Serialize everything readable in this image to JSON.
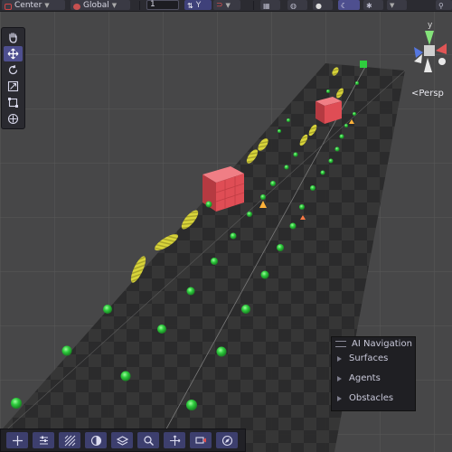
{
  "toolbar": {
    "pivot_label": "Center",
    "space_label": "Global",
    "snap_value": "1",
    "axis_label": "Y"
  },
  "tools": [
    "hand-tool",
    "move-tool",
    "rotate-tool",
    "scale-tool",
    "rect-tool",
    "transform-tool"
  ],
  "active_tool": "move-tool",
  "scene_view": {
    "projection_label": "<Persp",
    "gizmo_axis_label": "y"
  },
  "ai_navigation": {
    "title": "AI Navigation",
    "items": [
      {
        "label": "Surfaces"
      },
      {
        "label": "Agents"
      },
      {
        "label": "Obstacles"
      }
    ]
  },
  "overlay_tools": [
    "move-overlay",
    "settings-overlay",
    "grid-overlay",
    "draw-mode",
    "layers-overlay",
    "search-overlay",
    "transform-overlay",
    "camera-overlay",
    "navigation-overlay"
  ],
  "colors": {
    "background": "#454547",
    "accent": "#4e4f8f",
    "waypoint_green": "#2fcc3e",
    "ellipse_yellow": "#d8d43a",
    "obstacle_red": "#df4d55"
  }
}
